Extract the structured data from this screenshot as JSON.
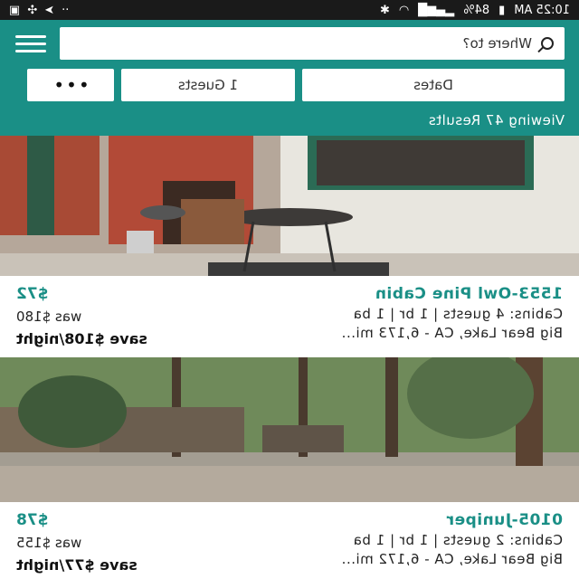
{
  "status": {
    "time": "10:25 AM",
    "battery": "84%"
  },
  "search": {
    "placeholder": "Where to?"
  },
  "filters": {
    "dates": "Dates",
    "guests": "1 Guests",
    "more": "•••"
  },
  "results": {
    "text": "Viewing 47 Results"
  },
  "listings": [
    {
      "title": "1553-Owl Pine Cabin",
      "details": "Cabins: 4 guests | 1 br | 1 ba",
      "location": "Big Bear Lake, CA - 6,173 mi...",
      "price": "$72",
      "was": "was $180",
      "save": "save $108/night"
    },
    {
      "title": "0105-Juniper",
      "details": "Cabins: 2 guests | 1 br | 1 ba",
      "location": "Big Bear Lake, CA - 6,172 mi...",
      "price": "$78",
      "was": "was $155",
      "save": "save $77/night"
    }
  ]
}
